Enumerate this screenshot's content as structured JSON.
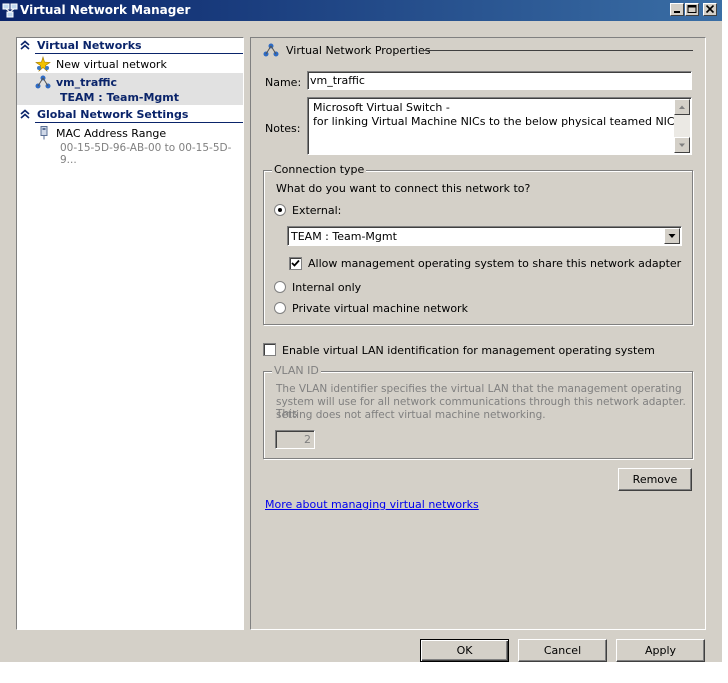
{
  "window": {
    "title": "Virtual Network Manager"
  },
  "sidebar": {
    "virtual_networks_header": "Virtual Networks",
    "new_network": "New virtual network",
    "network": {
      "name": "vm_traffic",
      "adapter": "TEAM : Team-Mgmt"
    },
    "global_settings_header": "Global Network Settings",
    "mac_range": {
      "label": "MAC Address Range",
      "value": "00-15-5D-96-AB-00 to 00-15-5D-9..."
    }
  },
  "properties": {
    "section_title": "Virtual Network Properties",
    "name_label": "Name:",
    "name_value": "vm_traffic",
    "notes_label": "Notes:",
    "notes_line1": "Microsoft Virtual Switch -",
    "notes_line2": "for linking Virtual Machine NICs to the below physical teamed NIC",
    "connection_type": {
      "legend": "Connection type",
      "question": "What do you want to connect this network to?",
      "external_label": "External:",
      "adapter_selected": "TEAM : Team-Mgmt",
      "allow_mgmt_label": "Allow management operating system to share this network adapter",
      "internal_label": "Internal only",
      "private_label": "Private virtual machine network"
    },
    "vlan": {
      "enable_label": "Enable virtual LAN identification for management operating system",
      "legend": "VLAN ID",
      "description_line1": "The VLAN identifier specifies the virtual LAN that the management operating",
      "description_line2": "system will use for all network communications through this network adapter. This",
      "description_line3": "setting does not affect virtual machine networking.",
      "value": "2"
    },
    "remove_label": "Remove",
    "help_link": "More about managing virtual networks"
  },
  "footer": {
    "ok": "OK",
    "cancel": "Cancel",
    "apply": "Apply"
  }
}
